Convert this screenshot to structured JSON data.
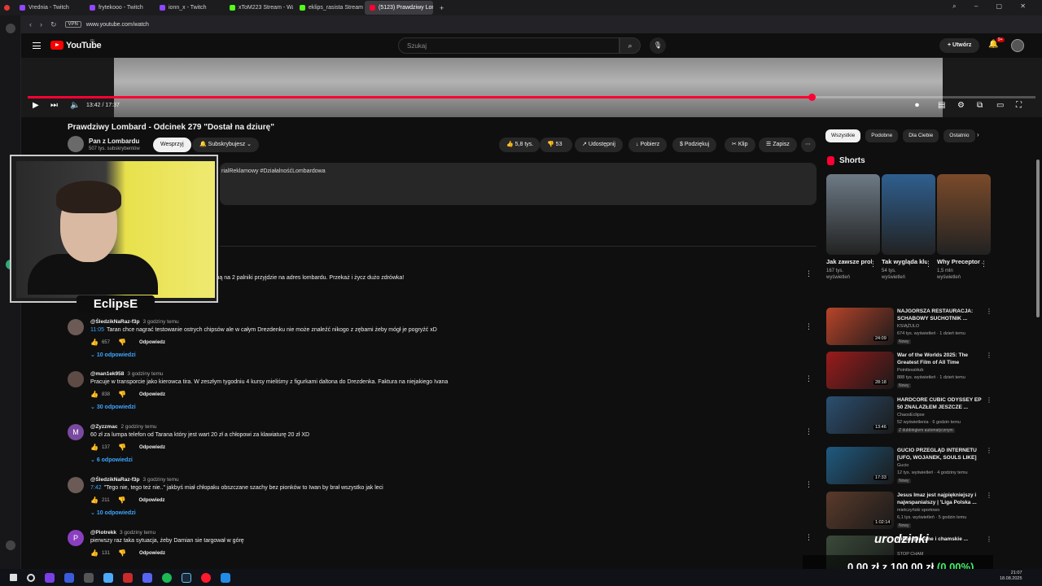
{
  "browser": {
    "tabs": [
      {
        "label": "Vrednia - Twitch",
        "color": "#9146ff",
        "active": false
      },
      {
        "label": "frytekooo - Twitch",
        "color": "#9146ff",
        "active": false
      },
      {
        "label": "ionn_x - Twitch",
        "color": "#9146ff",
        "active": false
      },
      {
        "label": "xToM223 Stream - Watch",
        "color": "#53fc18",
        "active": false
      },
      {
        "label": "eklips_rasista Stream - Ki",
        "color": "#53fc18",
        "active": false
      },
      {
        "label": "(5123) Prawdziwy Lombar",
        "color": "#ff0033",
        "active": true
      }
    ],
    "url": "www.youtube.com/watch",
    "vpn_label": "VPN"
  },
  "header": {
    "logo_text": "YouTube",
    "region": "PL",
    "search_placeholder": "Szukaj",
    "create_label": "Utwórz",
    "notif_badge": "9+"
  },
  "player": {
    "time": "13:42 / 17:37",
    "progress": 0.778
  },
  "video": {
    "title": "Prawdziwy Lombard - Odcinek 279 \"Dostał na dziurę\"",
    "channel": "Pan z Lombardu",
    "subs": "507 tys. subskrybentów",
    "support_label": "Wesprzyj",
    "subscribe_label": "Subskrybujesz",
    "likes": "5,8 tys.",
    "dislikes": "53",
    "share_label": "Udostępnij",
    "download_label": "Pobierz",
    "thanks_label": "Podziękuj",
    "clip_label": "Klip",
    "save_label": "Zapisz",
    "desc_fragment": "rialReklamowy #DziałalnośćLombardowa"
  },
  "overlay": {
    "streamer_name": "EclipsE",
    "donate_title": "urodzinki",
    "donate_current": "0,00 zł",
    "donate_sep": "z",
    "donate_goal": "100,00 zł",
    "donate_pct": "(0.00%)"
  },
  "comments": {
    "top_partial": "zną na 2 palniki przyjdzie na adres lombardu. Przekaż i życz dużo zdrówka!",
    "reply_label": "Odpowiedz",
    "items": [
      {
        "initial": "",
        "author": "@ŚledzikNaRaz-f3p",
        "time": "3 godziny temu",
        "ts": "11:05",
        "text": "Taran chce nagrać testowanie ostrych chipsów ale w całym Drezdenku nie może znaleźć nikogo z zębami żeby mógł je pogryźć xD",
        "likes": "657",
        "replies": "10 odpowiedzi"
      },
      {
        "initial": "",
        "author": "@man1ek958",
        "time": "3 godziny temu",
        "ts": "",
        "text": "Pracuje w transporcie jako kierowca tira. W zeszłym tygodniu 4 kursy mieliśmy z figurkami daltona do Drezdenka. Faktura na niejakiego Ivana",
        "likes": "838",
        "replies": "30 odpowiedzi"
      },
      {
        "initial": "M",
        "author": "@Zyzzmac",
        "time": "2 godziny temu",
        "ts": "",
        "text": "60 zł za lumpa telefon od Tarana który jest wart 20 zł a chłopowi za klawiaturę 20 zł XD",
        "likes": "137",
        "replies": "6 odpowiedzi"
      },
      {
        "initial": "",
        "author": "@ŚledzikNaRaz-f3p",
        "time": "3 godziny temu",
        "ts": "7:42",
        "text": "\"Tego nie, tego też nie..\" jakbyś miał chłopaku obszczane szachy bez pionków to Iwan by brał wszystko jak leci",
        "likes": "211",
        "replies": "10 odpowiedzi"
      },
      {
        "initial": "P",
        "author": "@Piotrekk",
        "time": "3 godziny temu",
        "ts": "",
        "text": "pierwszy raz taka sytuacja, żeby Damian sie targował w górę",
        "likes": "131",
        "replies": ""
      }
    ]
  },
  "sidebar": {
    "chips": [
      "Wszystkie",
      "Podobne",
      "Dla Ciebie",
      "Ostatnio"
    ],
    "shorts_title": "Shorts",
    "shorts": [
      {
        "title": "Jak zawsze problem z ...",
        "views": "167 tys.",
        "views2": "wyświetleń",
        "color": "#6d7a86"
      },
      {
        "title": "Tak wygląda klub z 1. Li...",
        "views": "54 tys.",
        "views2": "wyświetleń",
        "color": "#2f5f8f"
      },
      {
        "title": "Why Preceptor ...",
        "views": "1,5 mln",
        "views2": "wyświetleń",
        "color": "#7a4a2a"
      }
    ],
    "videos": [
      {
        "title": "NAJGORSZA RESTAURACJA: SCHABOWY SUCHOTNIK ...",
        "channel": "KSIĄŻULO",
        "meta": "674 tys. wyświetleń · 1 dzień temu",
        "badge": "Nowy",
        "duration": "24:09",
        "color": "#b8442a"
      },
      {
        "title": "War of the Worlds 2025: The Greatest Film of All Time",
        "channel": "PointlessHub",
        "meta": "888 tys. wyświetleń · 1 dzień temu",
        "badge": "Nowy",
        "duration": "28:18",
        "color": "#9a1b1b"
      },
      {
        "title": "HARDCORE CUBIC ODYSSEY EP 50 ZNALAZŁEM JESZCZE ...",
        "channel": "ChaosEclipse",
        "meta": "52 wyświetlenia · 6 godzin temu",
        "badge": "Z dubbingiem automatycznym",
        "duration": "13:46",
        "color": "#2c4f70"
      },
      {
        "title": "GUCIO PRZEGLĄD INTERNETU [UFO, WOJANEK, SOULS LIKE]",
        "channel": "Gucio",
        "meta": "12 tys. wyświetleń · 4 godziny temu",
        "badge": "Nowy",
        "duration": "17:33",
        "color": "#1f5a80"
      },
      {
        "title": "Jesus Imaz jest najpiękniejszy i najwspanialszy | 'Liga Polska ...",
        "channel": "mietczyński sportowo",
        "meta": "6,1 tys. wyświetleń · 5 godzin temu",
        "badge": "Nowy",
        "duration": "1:02:14",
        "color": "#5a3a2a"
      },
      {
        "title": "Niebezpieczne i chamskie ...",
        "channel": "STOP CHAM",
        "meta": "",
        "badge": "",
        "duration": "",
        "color": "#3a4a3a"
      }
    ]
  },
  "taskbar": {
    "time": "21:07",
    "date": "18.08.2025"
  }
}
